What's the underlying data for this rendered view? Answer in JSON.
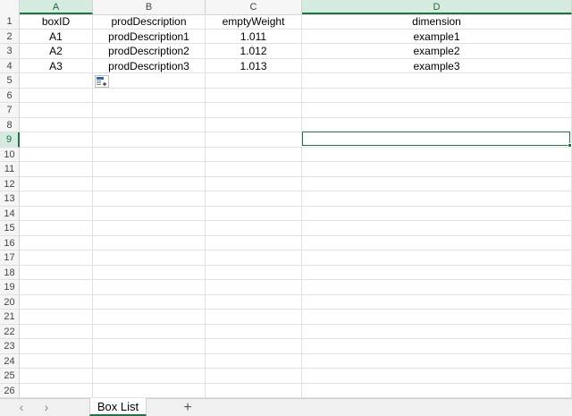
{
  "columns": [
    {
      "letter": "A",
      "selected": true
    },
    {
      "letter": "B",
      "selected": false
    },
    {
      "letter": "C",
      "selected": false
    },
    {
      "letter": "D",
      "selected": true
    }
  ],
  "rows": [
    {
      "num": "1",
      "cells": [
        "boxID",
        "prodDescription",
        "emptyWeight",
        "dimension"
      ]
    },
    {
      "num": "2",
      "cells": [
        "A1",
        "prodDescription1",
        "1.011",
        "example1"
      ]
    },
    {
      "num": "3",
      "cells": [
        "A2",
        "prodDescription2",
        "1.012",
        "example2"
      ]
    },
    {
      "num": "4",
      "cells": [
        "A3",
        "prodDescription3",
        "1.013",
        "example3"
      ]
    },
    {
      "num": "5",
      "cells": [
        "",
        "",
        "",
        ""
      ]
    },
    {
      "num": "6",
      "cells": [
        "",
        "",
        "",
        ""
      ]
    },
    {
      "num": "7",
      "cells": [
        "",
        "",
        "",
        ""
      ]
    },
    {
      "num": "8",
      "cells": [
        "",
        "",
        "",
        ""
      ]
    },
    {
      "num": "9",
      "cells": [
        "",
        "",
        "",
        ""
      ],
      "selected": true
    },
    {
      "num": "10",
      "cells": [
        "",
        "",
        "",
        ""
      ]
    },
    {
      "num": "11",
      "cells": [
        "",
        "",
        "",
        ""
      ]
    },
    {
      "num": "12",
      "cells": [
        "",
        "",
        "",
        ""
      ]
    },
    {
      "num": "13",
      "cells": [
        "",
        "",
        "",
        ""
      ]
    },
    {
      "num": "14",
      "cells": [
        "",
        "",
        "",
        ""
      ]
    },
    {
      "num": "15",
      "cells": [
        "",
        "",
        "",
        ""
      ]
    },
    {
      "num": "16",
      "cells": [
        "",
        "",
        "",
        ""
      ]
    },
    {
      "num": "17",
      "cells": [
        "",
        "",
        "",
        ""
      ]
    },
    {
      "num": "18",
      "cells": [
        "",
        "",
        "",
        ""
      ]
    },
    {
      "num": "19",
      "cells": [
        "",
        "",
        "",
        ""
      ]
    },
    {
      "num": "20",
      "cells": [
        "",
        "",
        "",
        ""
      ]
    },
    {
      "num": "21",
      "cells": [
        "",
        "",
        "",
        ""
      ]
    },
    {
      "num": "22",
      "cells": [
        "",
        "",
        "",
        ""
      ]
    },
    {
      "num": "23",
      "cells": [
        "",
        "",
        "",
        ""
      ]
    },
    {
      "num": "24",
      "cells": [
        "",
        "",
        "",
        ""
      ]
    },
    {
      "num": "25",
      "cells": [
        "",
        "",
        "",
        ""
      ]
    },
    {
      "num": "26",
      "cells": [
        "",
        "",
        "",
        ""
      ]
    }
  ],
  "active_cell": "D9",
  "sheet_tabs": [
    {
      "label": "Box List",
      "active": true
    }
  ],
  "nav": {
    "prev_icon": "chevron-left-icon",
    "next_icon": "chevron-right-icon",
    "add_icon": "plus-icon"
  },
  "quick_analysis_icon": "quick-analysis-icon",
  "colors": {
    "accent": "#217346",
    "selected_header_bg": "#d6ebdf",
    "header_bg": "#f5f5f5",
    "gridline": "#e1e1e1"
  }
}
